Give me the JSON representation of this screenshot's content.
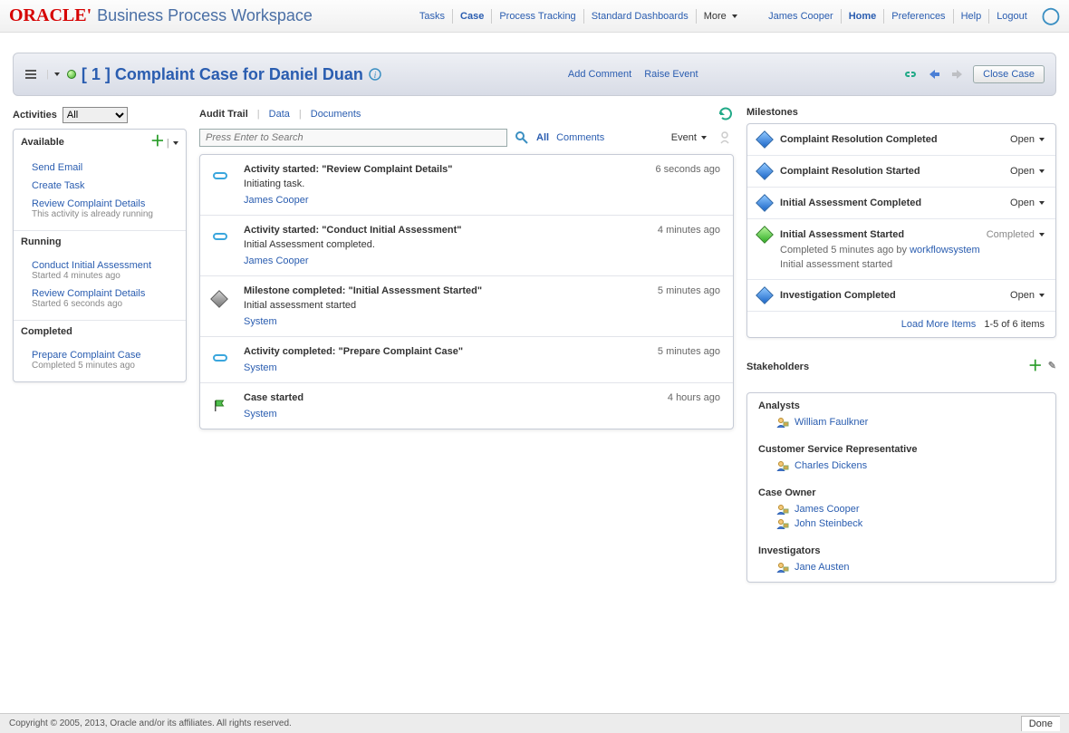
{
  "brand": {
    "oracle": "ORACLE'",
    "product": "Business Process Workspace"
  },
  "nav": {
    "tasks": "Tasks",
    "case": "Case",
    "tracking": "Process Tracking",
    "dashboards": "Standard Dashboards",
    "more": "More"
  },
  "user": {
    "name": "James Cooper",
    "home": "Home",
    "prefs": "Preferences",
    "help": "Help",
    "logout": "Logout"
  },
  "casebar": {
    "title": "[ 1 ] Complaint Case for Daniel Duan",
    "add_comment": "Add Comment",
    "raise_event": "Raise Event",
    "close": "Close Case"
  },
  "activities": {
    "label": "Activities",
    "filter": "All",
    "available_label": "Available",
    "available": [
      {
        "label": "Send Email"
      },
      {
        "label": "Create Task"
      },
      {
        "label": "Review Complaint Details",
        "sub": "This activity is already running"
      }
    ],
    "running_label": "Running",
    "running": [
      {
        "label": "Conduct Initial Assessment",
        "sub": "Started 4 minutes ago"
      },
      {
        "label": "Review Complaint Details",
        "sub": "Started 6 seconds ago"
      }
    ],
    "completed_label": "Completed",
    "completed": [
      {
        "label": "Prepare Complaint Case",
        "sub": "Completed 5 minutes ago"
      }
    ]
  },
  "tabs": {
    "audit": "Audit Trail",
    "data": "Data",
    "docs": "Documents"
  },
  "search": {
    "placeholder": "Press Enter to Search",
    "all": "All",
    "comments": "Comments",
    "event": "Event"
  },
  "trail": [
    {
      "icon": "pill",
      "title": "Activity started: \"Review Complaint Details\"",
      "time": "6 seconds ago",
      "desc": "Initiating task.",
      "who": "James Cooper"
    },
    {
      "icon": "pill",
      "title": "Activity started: \"Conduct Initial Assessment\"",
      "time": "4 minutes ago",
      "desc": "Initial Assessment completed.",
      "who": "James Cooper"
    },
    {
      "icon": "diamond",
      "title": "Milestone completed: \"Initial Assessment Started\"",
      "time": "5 minutes ago",
      "desc": "Initial assessment started",
      "who": "System"
    },
    {
      "icon": "pill",
      "title": "Activity completed: \"Prepare Complaint Case\"",
      "time": "5 minutes ago",
      "desc": "",
      "who": "System"
    },
    {
      "icon": "flag",
      "title": "Case started",
      "time": "4 hours ago",
      "desc": "",
      "who": "System"
    }
  ],
  "milestones": {
    "label": "Milestones",
    "rows": [
      {
        "icon": "blue",
        "title": "Complaint Resolution Completed",
        "state": "Open"
      },
      {
        "icon": "blue",
        "title": "Complaint Resolution Started",
        "state": "Open"
      },
      {
        "icon": "blue",
        "title": "Initial Assessment Completed",
        "state": "Open"
      },
      {
        "icon": "green",
        "title": "Initial Assessment Started",
        "state": "Completed",
        "detail_prefix": "Completed 5 minutes ago by ",
        "detail_link": "workflowsystem",
        "detail_text": "Initial assessment started"
      },
      {
        "icon": "blue",
        "title": "Investigation Completed",
        "state": "Open"
      }
    ],
    "load_more": "Load More Items",
    "pager": "1-5 of 6 items"
  },
  "stakeholders": {
    "label": "Stakeholders",
    "groups": [
      {
        "name": "Analysts",
        "people": [
          "William Faulkner"
        ]
      },
      {
        "name": "Customer Service Representative",
        "people": [
          "Charles Dickens"
        ]
      },
      {
        "name": "Case Owner",
        "people": [
          "James Cooper",
          "John Steinbeck"
        ]
      },
      {
        "name": "Investigators",
        "people": [
          "Jane Austen"
        ]
      }
    ]
  },
  "footer": {
    "copy": "Copyright © 2005, 2013, Oracle and/or its affiliates. All rights reserved.",
    "done": "Done"
  }
}
